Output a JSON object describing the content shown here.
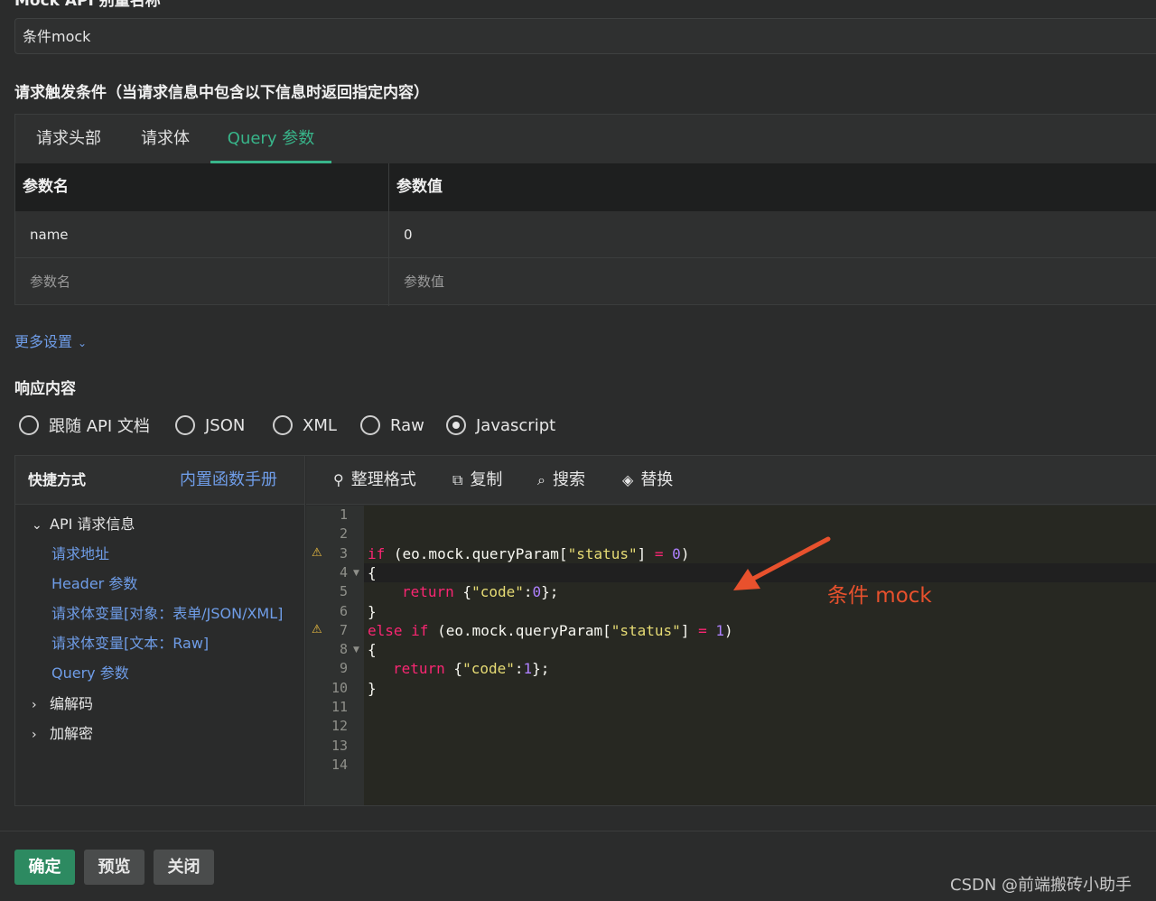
{
  "form": {
    "name_label": "Mock API 别量名称",
    "name_value": "条件mock",
    "trigger_title": "请求触发条件（当请求信息中包含以下信息时返回指定内容）"
  },
  "tabs": [
    {
      "label": "请求头部",
      "active": false
    },
    {
      "label": "请求体",
      "active": false
    },
    {
      "label": "Query 参数",
      "active": true
    }
  ],
  "params_table": {
    "headers": [
      "参数名",
      "参数值"
    ],
    "rows": [
      {
        "name": "name",
        "value": "0"
      }
    ],
    "placeholder_row": {
      "name": "参数名",
      "value": "参数值"
    }
  },
  "more_settings": "更多设置",
  "response": {
    "title": "响应内容",
    "options": [
      "跟随 API 文档",
      "JSON",
      "XML",
      "Raw",
      "Javascript"
    ],
    "selected": "Javascript"
  },
  "sidebar": {
    "title": "快捷方式",
    "manual_link": "内置函数手册",
    "tree": {
      "group1": "API 请求信息",
      "items": [
        "请求地址",
        "Header 参数",
        "请求体变量[对象：表单/JSON/XML]",
        "请求体变量[文本：Raw]",
        "Query 参数"
      ],
      "group2": "编解码",
      "group3": "加解密"
    }
  },
  "toolbar": {
    "format": "整理格式",
    "copy": "复制",
    "search": "搜索",
    "replace": "替换"
  },
  "code": {
    "line_numbers": [
      "1",
      "2",
      "3",
      "4",
      "5",
      "6",
      "7",
      "8",
      "9",
      "10",
      "11",
      "12",
      "13",
      "14"
    ],
    "l3": {
      "kw": "if",
      "a": " (eo.mock.queryParam[",
      "s": "\"status\"",
      "b": "] ",
      "op": "=",
      "c": " ",
      "n": "0",
      "d": ")"
    },
    "l4": "{",
    "l5": {
      "kw": "return",
      "a": " {",
      "s": "\"code\"",
      "b": ":",
      "n": "0",
      "c": "};"
    },
    "l6": "}",
    "l7": {
      "kw": "else if",
      "a": " (eo.mock.queryParam[",
      "s": "\"status\"",
      "b": "] ",
      "op": "=",
      "c": " ",
      "n": "1",
      "d": ")"
    },
    "l8": "{",
    "l9": {
      "kw": "return",
      "a": " {",
      "s": "\"code\"",
      "b": ":",
      "n": "1",
      "c": "};"
    },
    "l10": "}"
  },
  "annotation": "条件 mock",
  "buttons": {
    "confirm": "确定",
    "preview": "预览",
    "close": "关闭"
  },
  "watermark": "CSDN @前端搬砖小助手",
  "colors": {
    "accent": "#38b58a",
    "link": "#6f9de8",
    "annotation": "#e8512d",
    "primary_button": "#2d8a61"
  }
}
